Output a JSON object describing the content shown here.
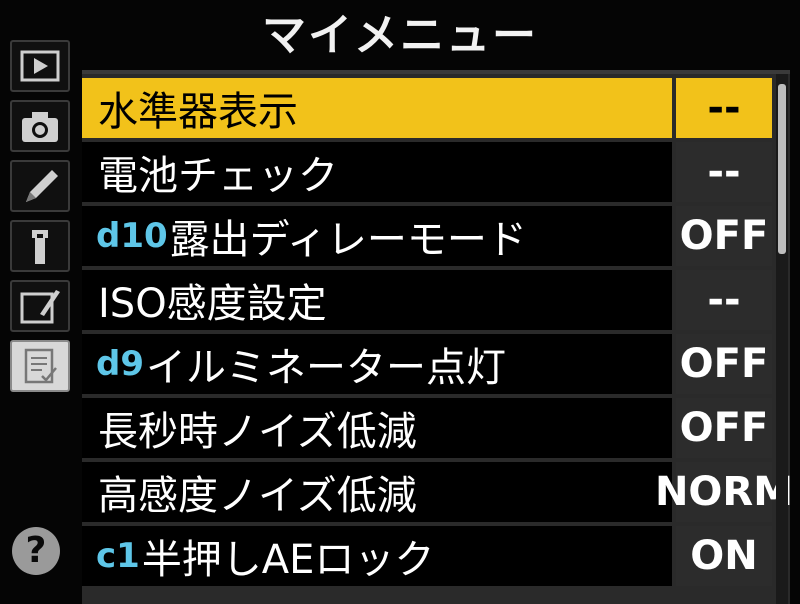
{
  "header": {
    "title": "マイメニュー"
  },
  "tabs": [
    {
      "name": "playback-menu",
      "icon": "playback-icon"
    },
    {
      "name": "shooting-menu",
      "icon": "camera-icon"
    },
    {
      "name": "custom-settings-menu",
      "icon": "pencil-icon"
    },
    {
      "name": "setup-menu",
      "icon": "wrench-icon"
    },
    {
      "name": "retouch-menu",
      "icon": "retouch-brush-icon"
    },
    {
      "name": "my-menu",
      "icon": "my-menu-icon",
      "active": true
    }
  ],
  "help_label": "?",
  "colors": {
    "highlight": "#f2c21a",
    "badge": "#5ec6e8",
    "value_bg": "#2c2c2c"
  },
  "menu_items": [
    {
      "badge": "",
      "label": "水準器表示",
      "value": "--",
      "selected": true
    },
    {
      "badge": "",
      "label": "電池チェック",
      "value": "--"
    },
    {
      "badge": "d10",
      "label": "露出ディレーモード",
      "value": "OFF"
    },
    {
      "badge": "",
      "label": "ISO感度設定",
      "value": "--"
    },
    {
      "badge": "d9",
      "label": "イルミネーター点灯",
      "value": "OFF"
    },
    {
      "badge": "",
      "label": "長秒時ノイズ低減",
      "value": "OFF"
    },
    {
      "badge": "",
      "label": "高感度ノイズ低減",
      "value": "NORM"
    },
    {
      "badge": "c1",
      "label": "半押しAEロック",
      "value": "ON"
    }
  ],
  "scroll": {
    "position_fraction": 0.0,
    "visible_fraction": 0.32
  }
}
